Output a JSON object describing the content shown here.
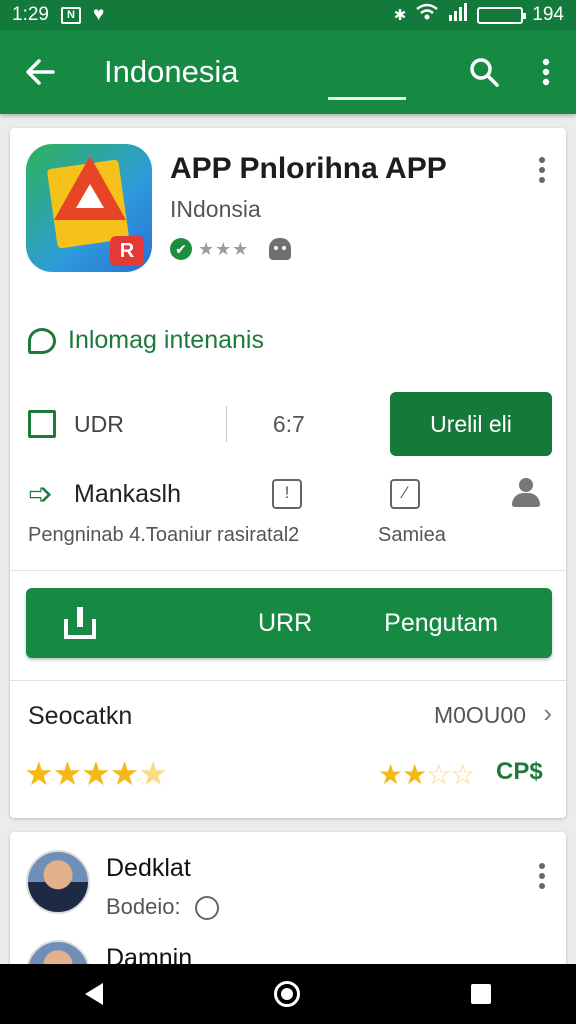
{
  "status": {
    "time": "1:29",
    "battery": "194"
  },
  "appbar": {
    "title": "Indonesia"
  },
  "app": {
    "title": "APP Pnlorihna APP",
    "subtitle": "INdonsia"
  },
  "chat_text": "Inlomag intenanis",
  "stats": {
    "left_label": "UDR",
    "middle_value": "6:7",
    "install_label": "Urelil eli"
  },
  "info": {
    "label": "Mankaslh",
    "sub_left": "Pengninab 4.Toaniur rasiratal2",
    "sub_right": "Samiea"
  },
  "install_bar": {
    "left_label": "URR",
    "right_label": "Pengutam"
  },
  "rating": {
    "title": "Seocatkn",
    "value": "M0OU00",
    "stars_left": 4.5,
    "stars_right": 2.5,
    "right_code": "CP$"
  },
  "reviews": [
    {
      "name": "Dedklat",
      "sub": "Bodeio:"
    },
    {
      "name": "Damnin",
      "sub": ""
    }
  ],
  "icons": {
    "back": "arrow-left-icon",
    "search": "search-icon",
    "more": "more-vert-icon",
    "chat": "chat-bubble-icon",
    "checkbox": "checkbox-icon",
    "arrow": "arrow-right-icon",
    "info1": "info-box-icon",
    "info2": "flag-box-icon",
    "person": "person-icon",
    "download": "download-icon",
    "chevron": "chevron-right-icon",
    "smiley": "smiley-icon"
  },
  "colors": {
    "appbar": "#168a43",
    "statusbar": "#137a3b",
    "accent": "#1e7a3b",
    "star": "#f5b916"
  }
}
